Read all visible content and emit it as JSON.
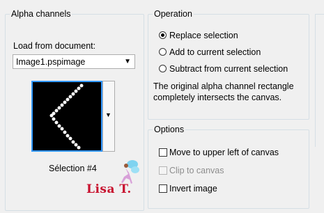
{
  "alpha_group": {
    "title": "Alpha channels",
    "load_label": "Load from document:",
    "document_value": "Image1.pspimage",
    "selection_name": "Sélection #4"
  },
  "operation_group": {
    "title": "Operation",
    "options": [
      {
        "label": "Replace selection",
        "selected": true
      },
      {
        "label": "Add to current selection",
        "selected": false
      },
      {
        "label": "Subtract from current selection",
        "selected": false
      }
    ],
    "description": "The original alpha channel rectangle completely intersects the canvas."
  },
  "options_group": {
    "title": "Options",
    "checkboxes": [
      {
        "label": "Move to upper left of canvas",
        "checked": false,
        "enabled": true
      },
      {
        "label": "Clip to canvas",
        "checked": false,
        "enabled": false
      },
      {
        "label": "Invert image",
        "checked": false,
        "enabled": true
      }
    ]
  },
  "watermark": {
    "text": "Lisa T."
  },
  "colors": {
    "focus_border": "#3399ff",
    "watermark_red": "#c8102e"
  }
}
